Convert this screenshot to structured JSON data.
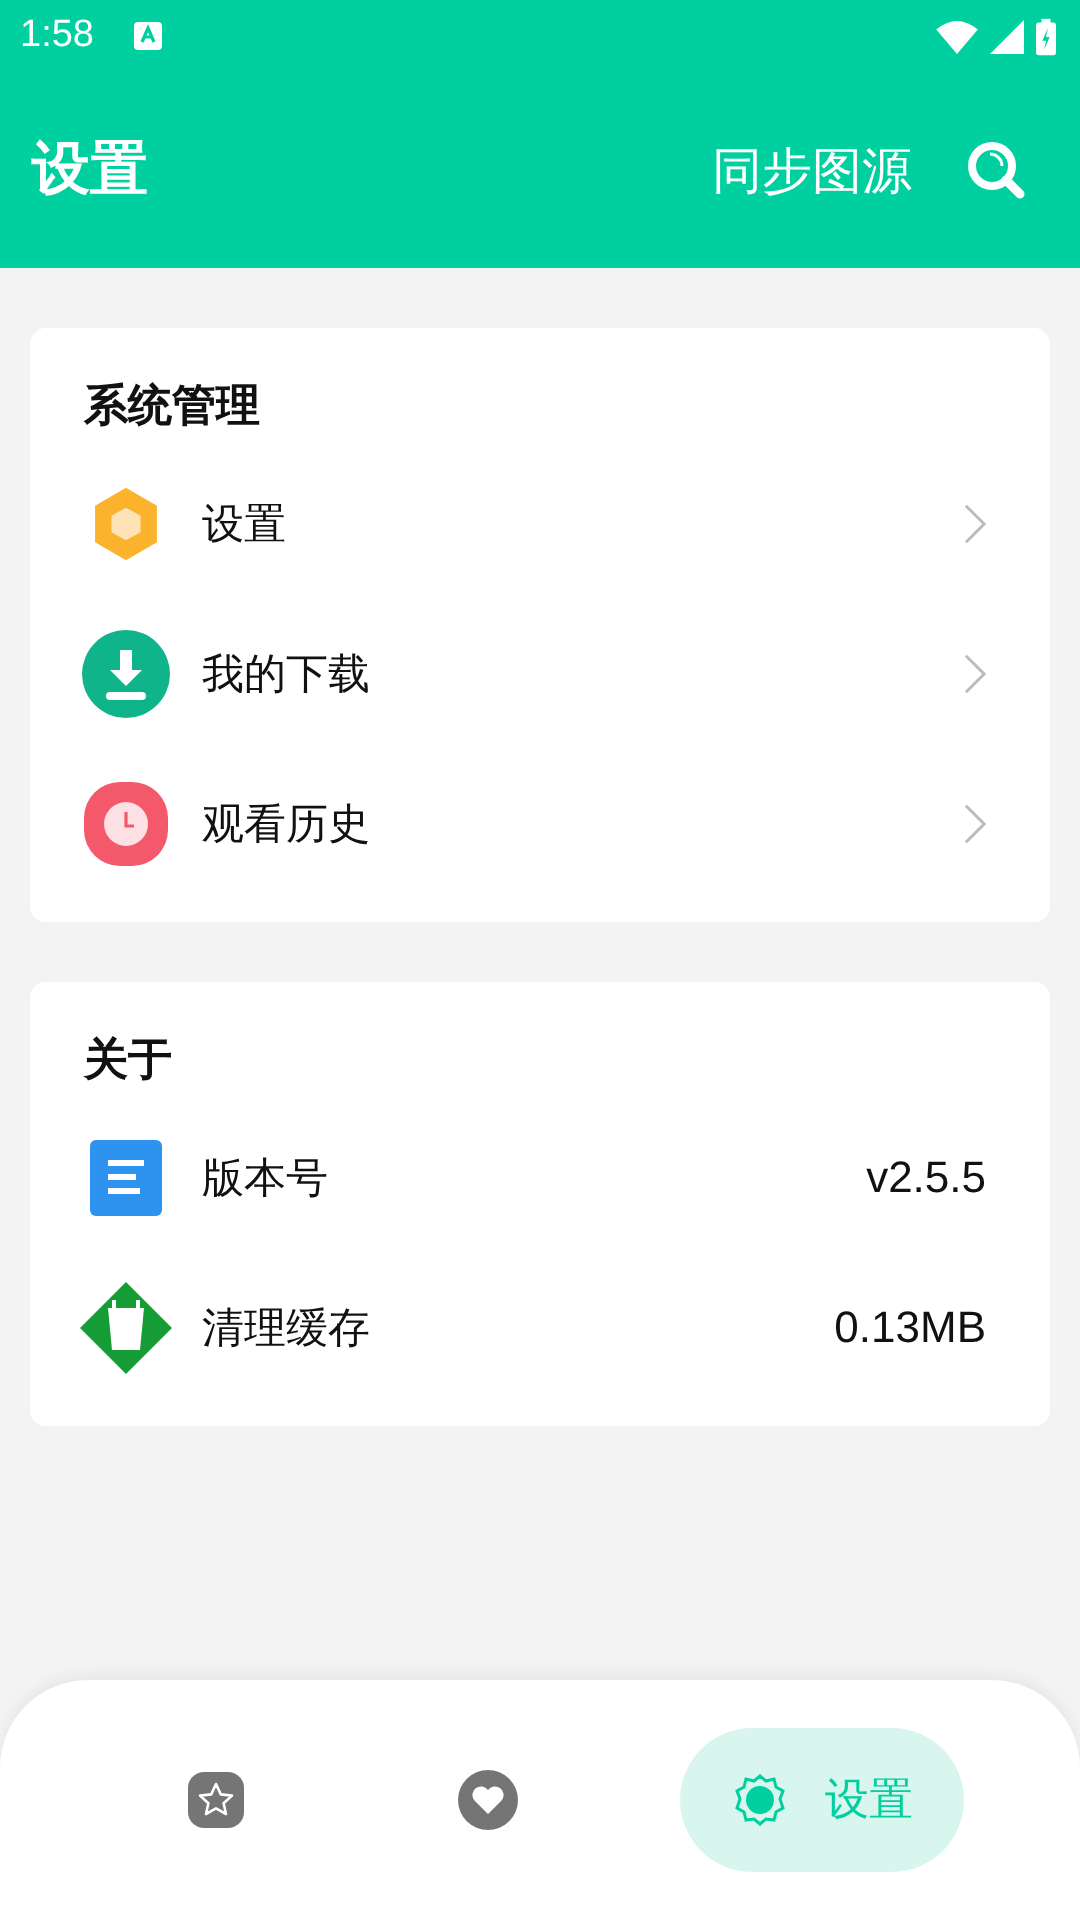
{
  "status_bar": {
    "time": "1:58"
  },
  "app_bar": {
    "title": "设置",
    "action": "同步图源"
  },
  "sections": [
    {
      "title": "系统管理",
      "items": [
        {
          "label": "设置"
        },
        {
          "label": "我的下载"
        },
        {
          "label": "观看历史"
        }
      ]
    },
    {
      "title": "关于",
      "items": [
        {
          "label": "版本号",
          "value": "v2.5.5"
        },
        {
          "label": "清理缓存",
          "value": "0.13MB"
        }
      ]
    }
  ],
  "bottom_nav": [
    {
      "selected": false
    },
    {
      "selected": false
    },
    {
      "label": "设置",
      "selected": true
    }
  ]
}
